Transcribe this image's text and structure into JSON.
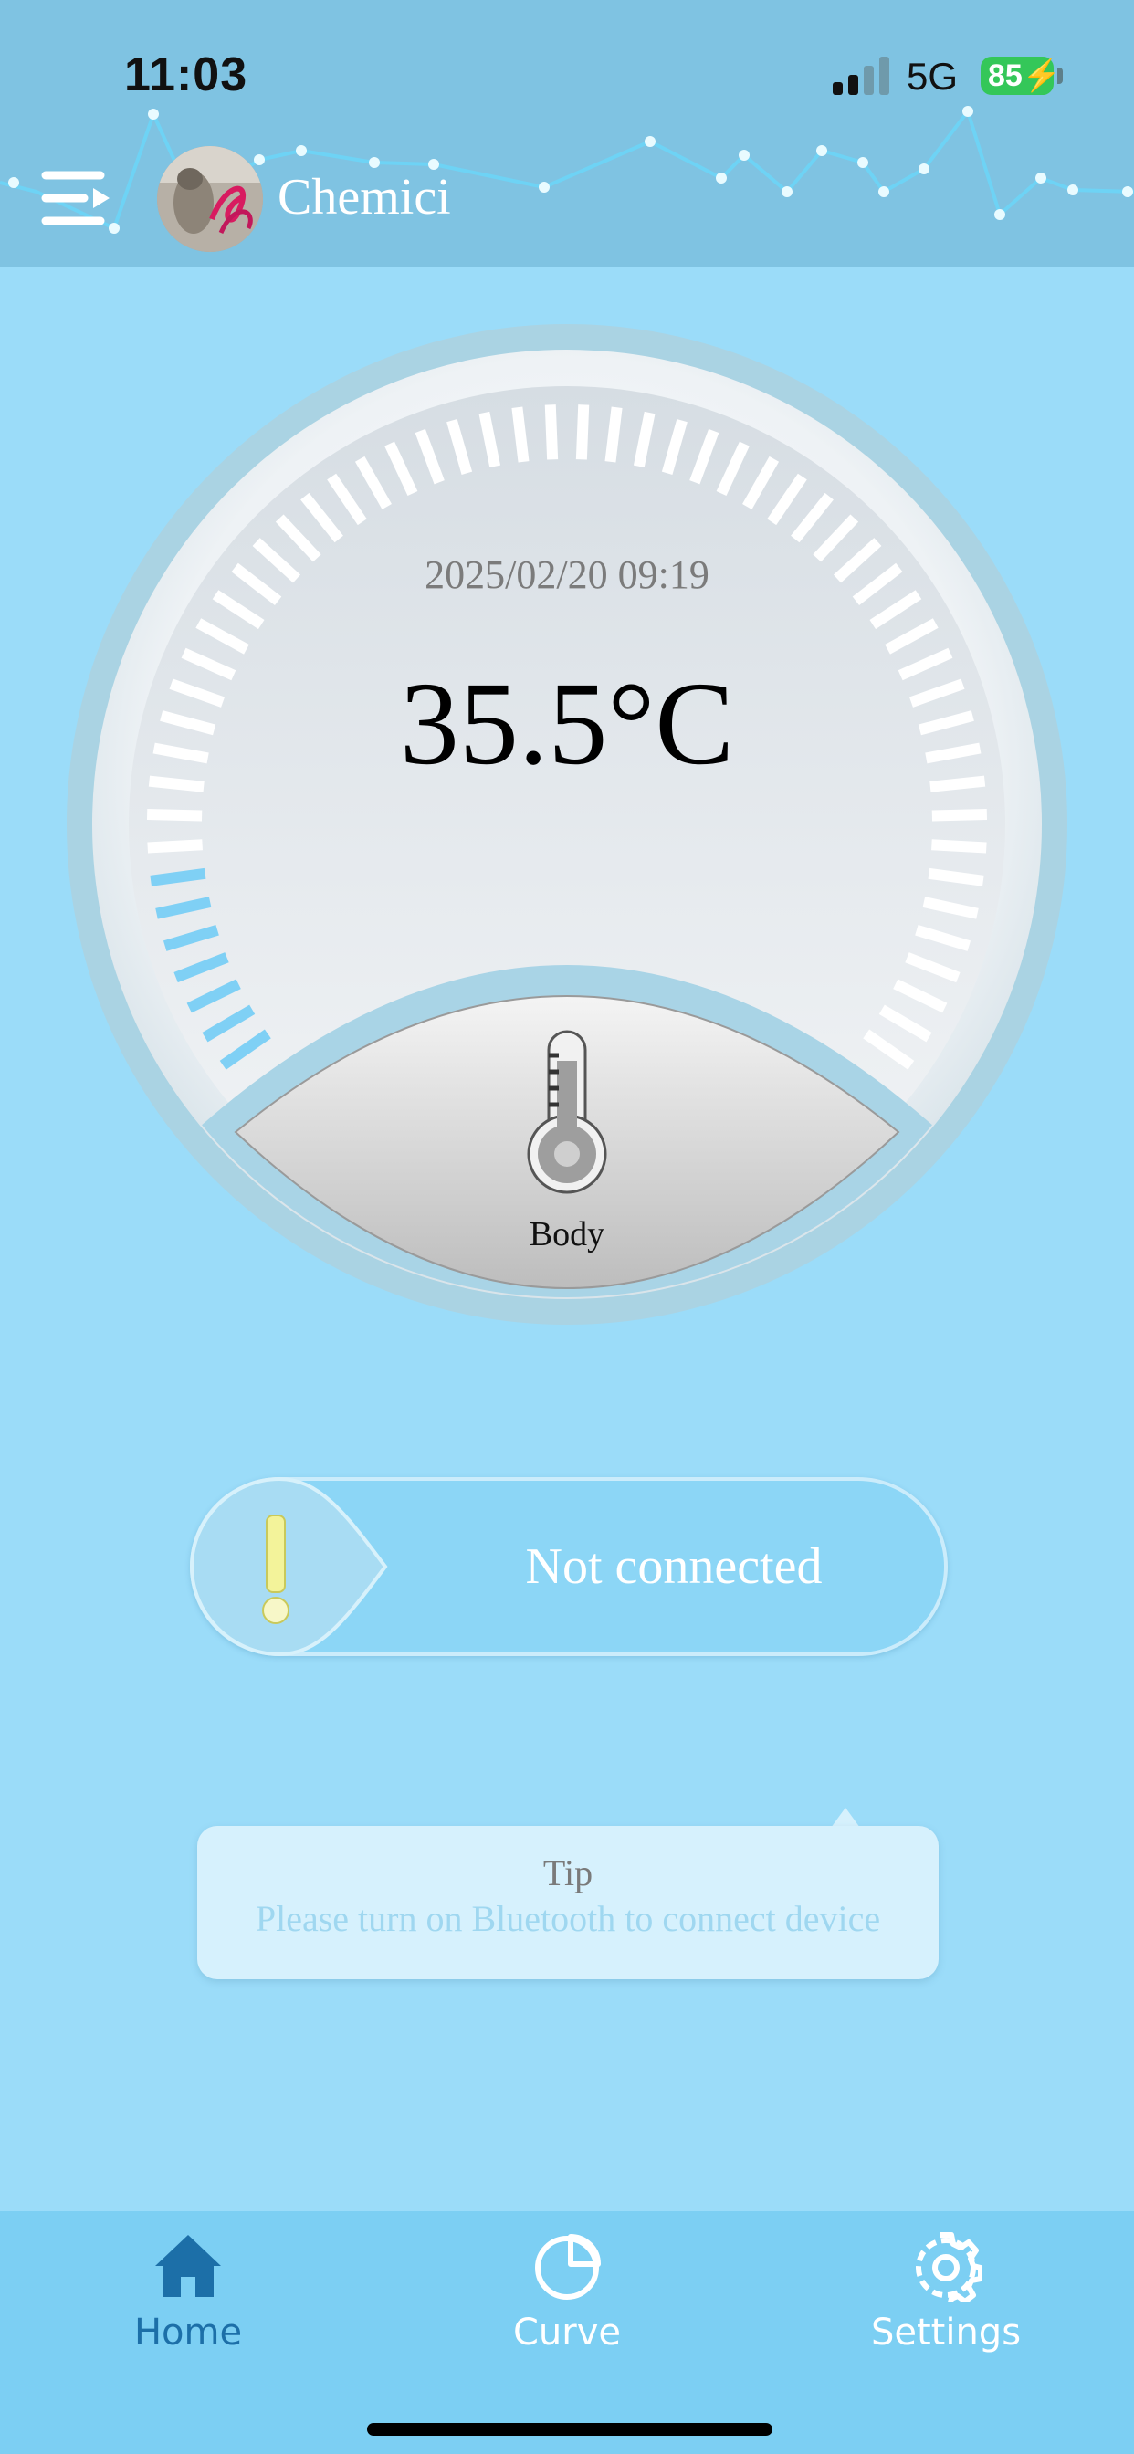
{
  "status_bar": {
    "time": "11:03",
    "network": "5G",
    "battery": "85"
  },
  "header": {
    "menu_icon": "menu-icon",
    "username": "Chemici",
    "background_color": "#7fc3e2"
  },
  "gauge": {
    "datetime": "2025/02/20 09:19",
    "temperature": "35.5°C",
    "mode_label": "Body",
    "mode_icon": "thermometer-icon",
    "active_tick_color": "#7fd0f5"
  },
  "connection": {
    "status_text": "Not connected",
    "status_icon": "exclamation-icon"
  },
  "tip": {
    "title": "Tip",
    "message": "Please turn on Bluetooth to connect device"
  },
  "tabs": [
    {
      "label": "Home",
      "icon": "home-icon",
      "active": true
    },
    {
      "label": "Curve",
      "icon": "pie-chart-icon",
      "active": false
    },
    {
      "label": "Settings",
      "icon": "gear-icon",
      "active": false
    }
  ],
  "colors": {
    "page_background": "#9bdcf9",
    "tab_bar": "#7ccff3",
    "active_tab": "#1c6fa8"
  }
}
